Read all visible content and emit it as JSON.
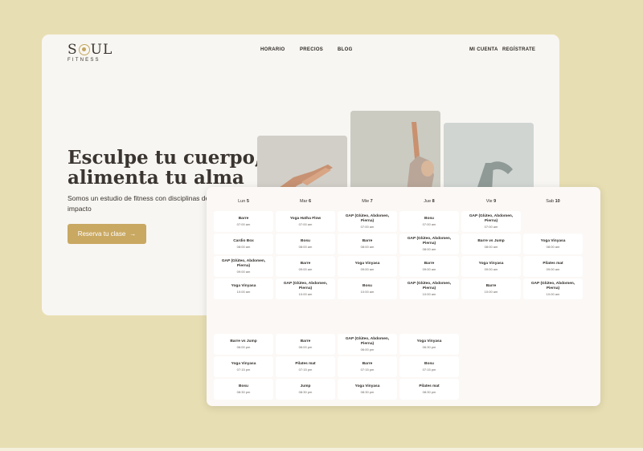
{
  "brand": {
    "name_s": "S",
    "name_ul": "UL",
    "sub": "FITNESS"
  },
  "nav": {
    "horario": "HORARIO",
    "precios": "PRECIOS",
    "blog": "BLOG",
    "mi_cuenta": "MI CUENTA",
    "registrate": "REGÍSTRATE"
  },
  "hero": {
    "title": "Esculpe tu cuerpo, alimenta tu alma",
    "subtitle": "Somos un estudio de fitness con disciplinas de bajo impacto",
    "cta_label": "Reserva tu clase",
    "cta_arrow": "→"
  },
  "schedule": {
    "days": [
      {
        "name": "Lun",
        "num": "5"
      },
      {
        "name": "Mar",
        "num": "6"
      },
      {
        "name": "Mie",
        "num": "7"
      },
      {
        "name": "Jue",
        "num": "8"
      },
      {
        "name": "Vie",
        "num": "9"
      },
      {
        "name": "Sab",
        "num": "10"
      }
    ],
    "columns": [
      {
        "morning": [
          {
            "name": "Barre",
            "time": "07:00 am"
          },
          {
            "name": "Cardio Box",
            "time": "08:00 am"
          },
          {
            "name": "GAP (Glúteo, Abdomen, Pierna)",
            "time": "09:00 am"
          },
          {
            "name": "Yoga Vinyasa",
            "time": "10:00 am"
          }
        ],
        "evening": [
          {
            "name": "Barre vs Jump",
            "time": "06:00 pm"
          },
          {
            "name": "Yoga Vinyasa",
            "time": "07:15 pm"
          },
          {
            "name": "Bosu",
            "time": "08:30 pm"
          }
        ]
      },
      {
        "morning": [
          {
            "name": "Yoga Hatha Flow",
            "time": "07:00 am"
          },
          {
            "name": "Bosu",
            "time": "08:00 am"
          },
          {
            "name": "Barre",
            "time": "09:00 am"
          },
          {
            "name": "GAP (Glúteo, Abdomen, Pierna)",
            "time": "10:00 am"
          }
        ],
        "evening": [
          {
            "name": "Barre",
            "time": "06:00 pm"
          },
          {
            "name": "Pilates mat",
            "time": "07:15 pm"
          },
          {
            "name": "Jump",
            "time": "08:30 pm"
          }
        ]
      },
      {
        "morning": [
          {
            "name": "GAP (Glúteo, Abdomen, Pierna)",
            "time": "07:00 am"
          },
          {
            "name": "Barre",
            "time": "08:00 am"
          },
          {
            "name": "Yoga Vinyasa",
            "time": "09:00 am"
          },
          {
            "name": "Bosu",
            "time": "10:00 am"
          }
        ],
        "evening": [
          {
            "name": "GAP (Glúteo, Abdomen, Pierna)",
            "time": "06:00 pm"
          },
          {
            "name": "Barre",
            "time": "07:15 pm"
          },
          {
            "name": "Yoga Vinyasa",
            "time": "08:30 pm"
          }
        ]
      },
      {
        "morning": [
          {
            "name": "Bosu",
            "time": "07:00 am"
          },
          {
            "name": "GAP (Glúteo, Abdomen, Pierna)",
            "time": "08:00 am"
          },
          {
            "name": "Barre",
            "time": "09:00 am"
          },
          {
            "name": "GAP (Glúteo, Abdomen, Pierna)",
            "time": "10:00 am"
          }
        ],
        "evening": [
          {
            "name": "Yoga Vinyasa",
            "time": "06:30 pm"
          },
          {
            "name": "Bosu",
            "time": "07:15 pm"
          },
          {
            "name": "Pilates mat",
            "time": "08:30 pm"
          }
        ]
      },
      {
        "morning": [
          {
            "name": "GAP (Glúteo, Abdomen, Pierna)",
            "time": "07:00 am"
          },
          {
            "name": "Barre vs Jump",
            "time": "08:00 am"
          },
          {
            "name": "Yoga Vinyasa",
            "time": "09:00 am"
          },
          {
            "name": "Barre",
            "time": "10:00 am"
          }
        ],
        "evening": []
      },
      {
        "morning": [
          {
            "name": "Yoga Vinyasa",
            "time": "08:00 am"
          },
          {
            "name": "Pilates mat",
            "time": "09:00 am"
          },
          {
            "name": "GAP (Glúteo, Abdomen, Pierna)",
            "time": "10:00 am"
          }
        ],
        "evening": []
      }
    ]
  },
  "colors": {
    "background": "#e8deb3",
    "card": "#f8f6f2",
    "accent": "#c9a862",
    "text": "#3a3530"
  }
}
